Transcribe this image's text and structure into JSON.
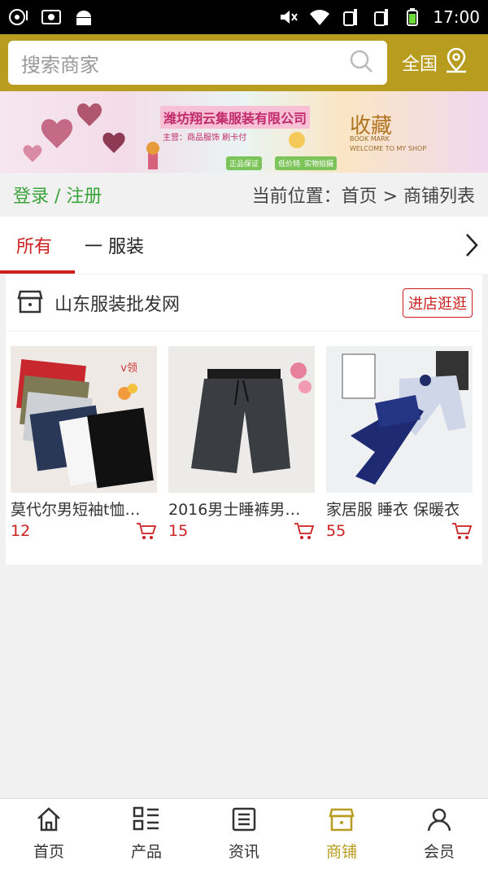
{
  "status_bar": {
    "time": "17:00"
  },
  "search": {
    "placeholder": "搜索商家"
  },
  "region": {
    "label": "全国"
  },
  "banner": {
    "company": "潍坊翔云集服装有限公司",
    "subtitle": "主营：商品服饰 刷卡付",
    "script_text": "收藏",
    "script_sub": "BOOK MARK",
    "welcome": "WELCOME TO MY SHOP",
    "tags": [
      "正品保证",
      "低价特惠",
      "实物拍摄"
    ]
  },
  "breadcrumb": {
    "login": "登录 / 注册",
    "location": "当前位置：首页 > 商铺列表"
  },
  "tabs": [
    {
      "label": "所有"
    },
    {
      "label": "一 服装"
    }
  ],
  "shop": {
    "name": "山东服装批发网",
    "enter_button": "进店逛逛",
    "products": [
      {
        "name": "莫代尔男短袖t恤…",
        "price": "12",
        "overlay": "v领"
      },
      {
        "name": "2016男士睡裤男…",
        "price": "15"
      },
      {
        "name": "家居服 睡衣 保暖衣",
        "price": "55"
      }
    ]
  },
  "nav": [
    {
      "label": "首页",
      "icon": "home-icon"
    },
    {
      "label": "产品",
      "icon": "grid-list-icon"
    },
    {
      "label": "资讯",
      "icon": "news-icon"
    },
    {
      "label": "商铺",
      "icon": "store-icon"
    },
    {
      "label": "会员",
      "icon": "user-icon"
    }
  ],
  "colors": {
    "brand": "#b89c1f",
    "accent_red": "#cc1f1f",
    "login_green": "#3aa33a"
  }
}
